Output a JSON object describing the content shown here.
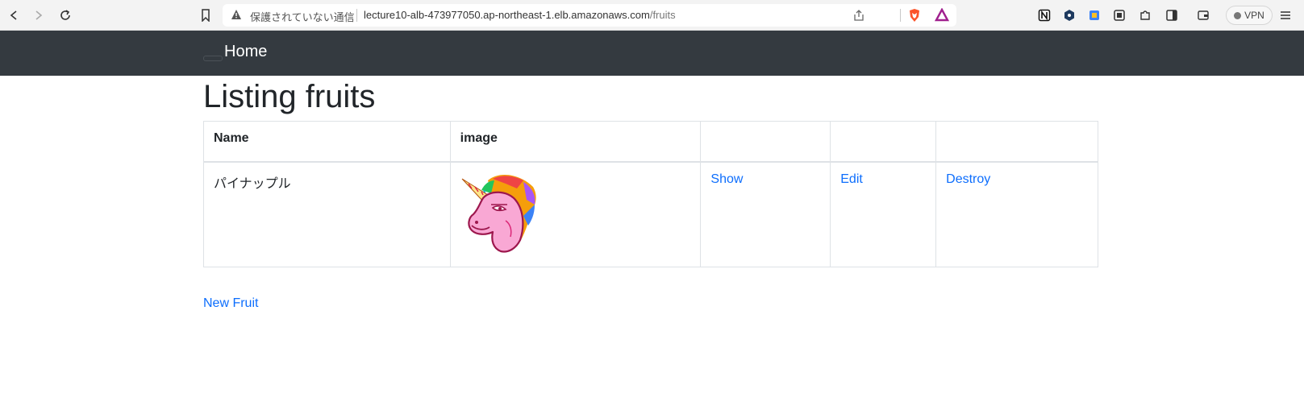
{
  "browser": {
    "url_host": "lecture10-alb-473977050.ap-northeast-1.elb.amazonaws.com",
    "url_path": "/fruits",
    "security_label": "保護されていない通信",
    "vpn_label": "VPN"
  },
  "navbar": {
    "brand": "Home"
  },
  "page": {
    "title": "Listing fruits",
    "new_link": "New Fruit"
  },
  "table": {
    "headers": [
      "Name",
      "image",
      "",
      "",
      ""
    ],
    "rows": [
      {
        "name": "パイナップル",
        "image": "unicorn-head-logo",
        "show": "Show",
        "edit": "Edit",
        "destroy": "Destroy"
      }
    ]
  },
  "colors": {
    "navbar_bg": "#343a40",
    "link": "#0d6efd"
  }
}
